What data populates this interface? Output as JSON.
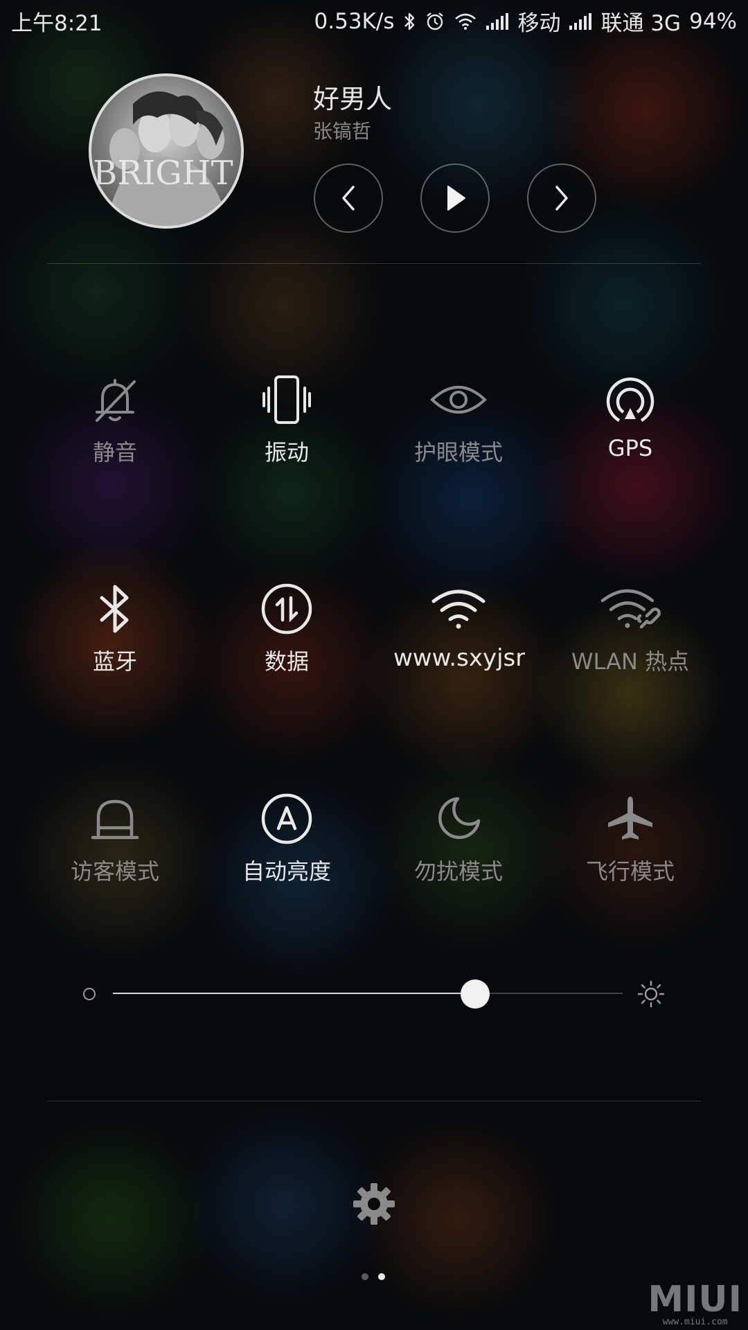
{
  "status_bar": {
    "time": "上午8:21",
    "net_speed": "0.53K/s",
    "carrier_1": "移动",
    "carrier_2": "联通 3G",
    "battery": "94%",
    "icons": [
      "bluetooth-icon",
      "alarm-icon",
      "wifi-icon",
      "signal-icon",
      "signal-icon"
    ]
  },
  "music": {
    "album_art_text": "BRIGHT",
    "title": "好男人",
    "artist": "张镐哲",
    "controls": [
      "previous",
      "play",
      "next"
    ]
  },
  "toggles": [
    {
      "label": "静音",
      "icon": "bell-off-icon",
      "active": false
    },
    {
      "label": "振动",
      "icon": "vibrate-icon",
      "active": true
    },
    {
      "label": "护眼模式",
      "icon": "eye-icon",
      "active": false
    },
    {
      "label": "GPS",
      "icon": "gps-icon",
      "active": true
    },
    {
      "label": "蓝牙",
      "icon": "bluetooth-icon",
      "active": true
    },
    {
      "label": "数据",
      "icon": "data-icon",
      "active": true
    },
    {
      "label": "www.sxyjsr",
      "icon": "wifi-icon",
      "active": true
    },
    {
      "label": "WLAN 热点",
      "icon": "hotspot-icon",
      "active": false
    },
    {
      "label": "访客模式",
      "icon": "guest-icon",
      "active": false
    },
    {
      "label": "自动亮度",
      "icon": "auto-brightness-icon",
      "active": true
    },
    {
      "label": "勿扰模式",
      "icon": "moon-icon",
      "active": false
    },
    {
      "label": "飞行模式",
      "icon": "airplane-icon",
      "active": false
    }
  ],
  "brightness": {
    "level": 0.71
  },
  "pager": {
    "pages": 2,
    "current": 2
  },
  "watermark": {
    "logo": "MIUI",
    "url": "www.miui.com"
  },
  "colors": {
    "active": "#e8e8e8",
    "inactive": "#8a8a8a",
    "background": "#07090c"
  }
}
